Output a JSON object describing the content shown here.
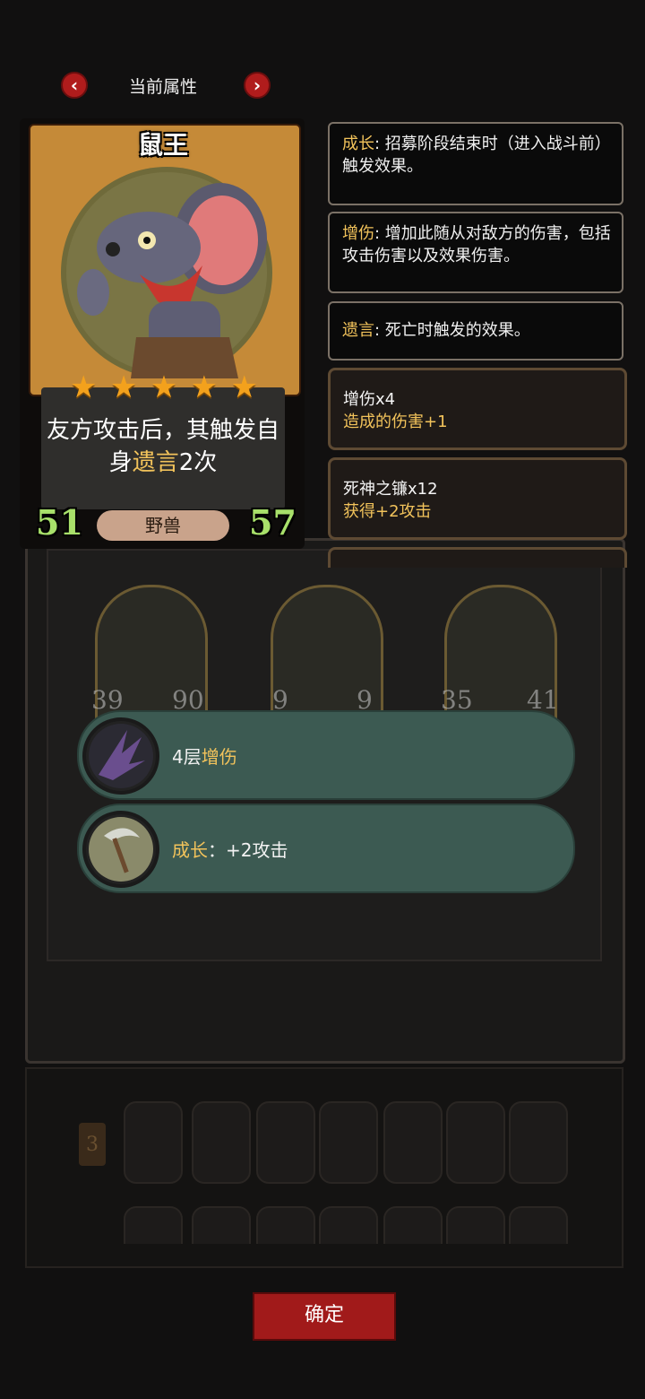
{
  "header": {
    "title": "当前属性",
    "prev_icon": "‹",
    "next_icon": "›"
  },
  "card": {
    "name": "鼠王",
    "stars": 5,
    "desc_before": "友方攻击后，其触发自身",
    "desc_keyword": "遗言",
    "desc_after": "2次",
    "attack": "51",
    "health": "57",
    "tribe": "野兽"
  },
  "keywords": [
    {
      "name": "成长",
      "text": ": 招募阶段结束时（进入战斗前）触发效果。"
    },
    {
      "name": "增伤",
      "text": ": 增加此随从对敌方的伤害，包括攻击伤害以及效果伤害。"
    },
    {
      "name": "遗言",
      "text": ": 死亡时触发的效果。"
    }
  ],
  "buffs": [
    {
      "title": "增伤x4",
      "sub": "造成的伤害+1"
    },
    {
      "title": "死神之镰x12",
      "sub": "获得+2攻击"
    }
  ],
  "board_minions": [
    {
      "atk": "39",
      "hp": "90"
    },
    {
      "atk": "9",
      "hp": "9"
    },
    {
      "atk": "35",
      "hp": "41"
    }
  ],
  "effects": [
    {
      "prefix": "4层",
      "keyword": "增伤",
      "suffix": ""
    },
    {
      "prefix": "",
      "keyword": "成长",
      "suffix": "：+2攻击"
    }
  ],
  "shop": {
    "tier": "3"
  },
  "confirm_label": "确定",
  "colors": {
    "accent_red": "#a11a1a",
    "keyword_gold": "#f2c35b",
    "attack_green": "#a8e06a"
  }
}
